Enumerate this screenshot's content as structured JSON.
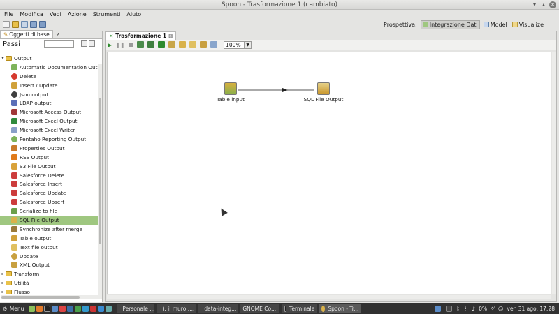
{
  "window": {
    "title": "Spoon - Trasformazione 1 (cambiato)"
  },
  "menu": [
    "File",
    "Modifica",
    "Vedi",
    "Azione",
    "Strumenti",
    "Aiuto"
  ],
  "perspective": {
    "label": "Prospettiva:",
    "buttons": [
      "Integrazione Dati",
      "Model",
      "Visualize"
    ],
    "active": "Integrazione Dati"
  },
  "left_panel": {
    "tabs": [
      "Oggetti di base",
      "↗"
    ],
    "passi_label": "Passi",
    "tree": {
      "output_folder": "Output",
      "output_items": [
        "Automatic Documentation Outp",
        "Delete",
        "Insert / Update",
        "Json output",
        "LDAP output",
        "Microsoft Access Output",
        "Microsoft Excel Output",
        "Microsoft Excel Writer",
        "Pentaho Reporting Output",
        "Properties Output",
        "RSS Output",
        "S3 File Output",
        "Salesforce Delete",
        "Salesforce Insert",
        "Salesforce Update",
        "Salesforce Upsert",
        "Serialize to file",
        "SQL File Output",
        "Synchronize after merge",
        "Table output",
        "Text file output",
        "Update",
        "XML Output"
      ],
      "selected": "SQL File Output",
      "other_folders": [
        "Transform",
        "Utilità",
        "Flusso"
      ]
    }
  },
  "editor": {
    "tab_label": "Trasformazione 1",
    "tab_close": "⊠",
    "zoom": "100%",
    "steps": {
      "table_input": "Table input",
      "sql_file_output": "SQL File Output"
    }
  },
  "taskbar": {
    "menu_label": "Menu",
    "tasks": [
      "Personale ...",
      "(: il muro :...",
      "data-integ...",
      "GNOME Co...",
      "Terminale",
      "Spoon - Tr..."
    ],
    "battery": "0%",
    "clock": "ven 31 ago, 17:28"
  },
  "colors": {
    "selected_row": "#9fc780",
    "taskbar": "#313131"
  }
}
